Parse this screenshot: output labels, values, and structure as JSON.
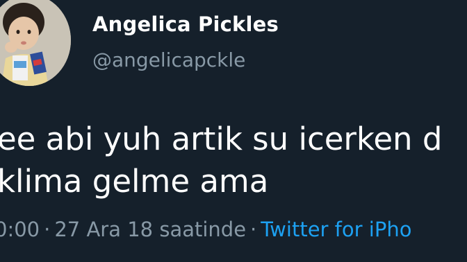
{
  "user": {
    "display_name": "Angelica Pickles",
    "handle": "@angelicapckle"
  },
  "tweet": {
    "lines": [
      "ee abi yuh artik su icerken d",
      "klima gelme ama"
    ]
  },
  "meta": {
    "time": "0:00",
    "separator": "·",
    "date": "27 Ara 18 saatinde",
    "separator2": "·",
    "source": "Twitter for iPho"
  },
  "colors": {
    "background": "#15202b",
    "secondary_text": "#8899a6",
    "link": "#1da1f2"
  },
  "icons": {
    "avatar": "profile-photo"
  }
}
